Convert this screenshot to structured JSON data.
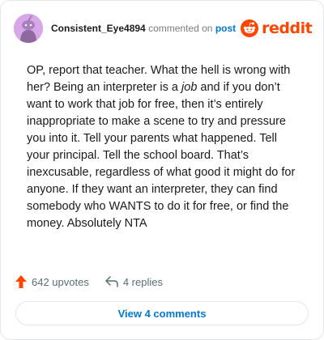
{
  "header": {
    "username": "Consistent_Eye4894",
    "action_text": "commented on",
    "post_link": "post",
    "brand": "reddit"
  },
  "comment": {
    "seg1": "OP, report that teacher. What the hell is wrong with her? Being an interpreter is a ",
    "seg2": "job",
    "seg3": " and if you don’t want to work that job for free, then it’s entirely inappropriate to make a scene to try and pressure you into it. Tell your parents what happened. Tell your principal. Tell the school board. That’s inexcusable, regardless of what good it might do for anyone. If they want an interpreter, they can find somebody who WANTS to do it for free, or find the money. Absolutely NTA"
  },
  "stats": {
    "upvotes": "642 upvotes",
    "replies": "4 replies"
  },
  "footer": {
    "view_label": "View 4 comments"
  },
  "colors": {
    "brand": "#ff4500",
    "link": "#0079d3",
    "upvote": "#ff4500",
    "avatar_bg": "#d9a6e8"
  },
  "icons": {
    "avatar": "snoo-avatar-icon",
    "brand": "reddit-logo-icon",
    "upvote": "upvote-arrow-icon",
    "reply": "reply-arrow-icon"
  }
}
